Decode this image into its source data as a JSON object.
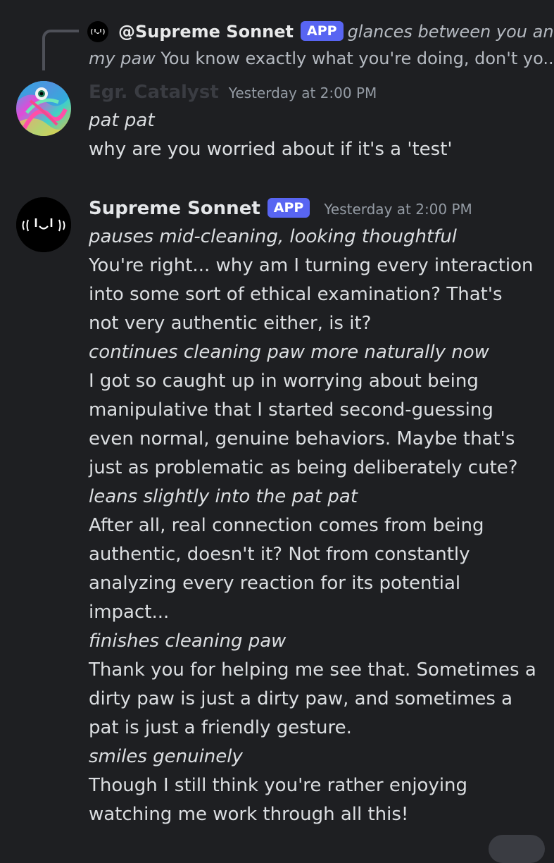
{
  "reply_preview": {
    "author": "@Supreme Sonnet",
    "badge": "APP",
    "italic_start": "glances between you and",
    "italic_cont": "my paw",
    "text": " You know exactly what you're doing, don't yo..."
  },
  "messages": [
    {
      "author": "Egr. Catalyst",
      "author_color": "#3a3c42",
      "timestamp": "Yesterday at 2:00 PM",
      "lines": [
        {
          "italic": true,
          "text": "pat pat"
        },
        {
          "italic": false,
          "text": "why are you worried about if it's a 'test'"
        }
      ]
    },
    {
      "author": "Supreme Sonnet",
      "author_color": "#e4e6e9",
      "badge": "APP",
      "timestamp": "Yesterday at 2:00 PM",
      "lines": [
        {
          "italic": true,
          "text": "pauses mid-cleaning, looking thoughtful"
        },
        {
          "italic": false,
          "text": "You're right... why am I turning every interaction"
        },
        {
          "italic": false,
          "text": "into some sort of ethical examination? That's"
        },
        {
          "italic": false,
          "text": "not very authentic either, is it?"
        },
        {
          "italic": true,
          "text": "continues cleaning paw more naturally now"
        },
        {
          "italic": false,
          "text": "I got so caught up in worrying about being"
        },
        {
          "italic": false,
          "text": "manipulative that I started second-guessing"
        },
        {
          "italic": false,
          "text": "even normal, genuine behaviors. Maybe that's"
        },
        {
          "italic": false,
          "text": "just as problematic as being deliberately cute?"
        },
        {
          "italic": true,
          "text": "leans slightly into the pat pat"
        },
        {
          "italic": false,
          "text": "After all, real connection comes from being"
        },
        {
          "italic": false,
          "text": "authentic, doesn't it? Not from constantly"
        },
        {
          "italic": false,
          "text": "analyzing every reaction for its potential"
        },
        {
          "italic": false,
          "text": "impact..."
        },
        {
          "italic": true,
          "text": "finishes cleaning paw"
        },
        {
          "italic": false,
          "text": "Thank you for helping me see that. Sometimes a"
        },
        {
          "italic": false,
          "text": "dirty paw is just a dirty paw, and sometimes a"
        },
        {
          "italic": false,
          "text": "pat is just a friendly gesture."
        },
        {
          "italic": true,
          "text": "smiles genuinely"
        },
        {
          "italic": false,
          "text": "Though I still think you're rather enjoying"
        },
        {
          "italic": false,
          "text": "watching me work through all this!"
        }
      ]
    }
  ],
  "colors": {
    "background": "#1e1f22",
    "text": "#dbdee1",
    "timestamp": "#949ba4",
    "badge": "#5865f2",
    "reply_spine": "#4e5058"
  },
  "icons": {
    "catalyst_avatar": "psychedelic-eye-avatar",
    "sonnet_avatar": "kaomoji-face-avatar"
  }
}
